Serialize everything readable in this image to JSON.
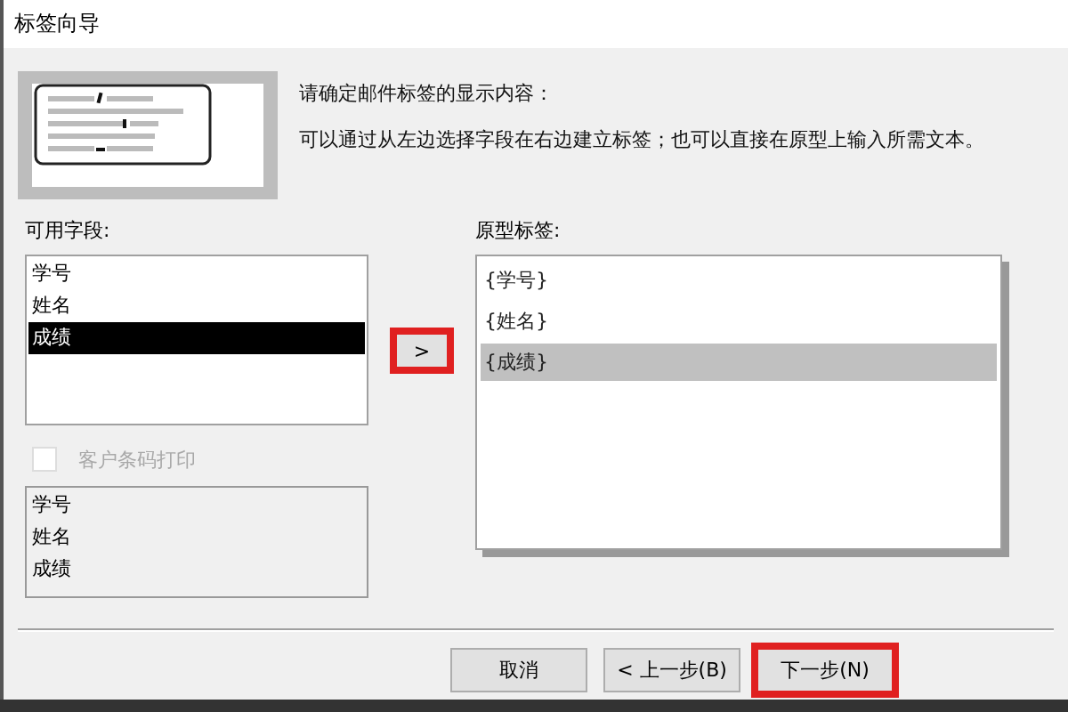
{
  "window": {
    "title": "标签向导"
  },
  "instructions": [
    "请确定邮件标签的显示内容：",
    "可以通过从左边选择字段在右边建立标签；也可以直接在原型上输入所需文本。"
  ],
  "available_fields": {
    "label": "可用字段:",
    "items": [
      {
        "text": "学号",
        "selected": false
      },
      {
        "text": "姓名",
        "selected": false
      },
      {
        "text": "成绩",
        "selected": true
      }
    ]
  },
  "add_button": {
    "label": ">",
    "highlighted": true
  },
  "barcode_option": {
    "label": "客户条码打印",
    "checked": false,
    "disabled": true
  },
  "barcode_fields": [
    "学号",
    "姓名",
    "成绩"
  ],
  "prototype": {
    "label": "原型标签:",
    "lines": [
      {
        "text": "{学号}",
        "selected": false
      },
      {
        "text": "{姓名}",
        "selected": false
      },
      {
        "text": "{成绩}",
        "selected": true
      }
    ]
  },
  "buttons": [
    {
      "label": "取消",
      "highlighted": false
    },
    {
      "label": "< 上一步(B)",
      "highlighted": false
    },
    {
      "label": "下一步(N)",
      "highlighted": true
    }
  ]
}
